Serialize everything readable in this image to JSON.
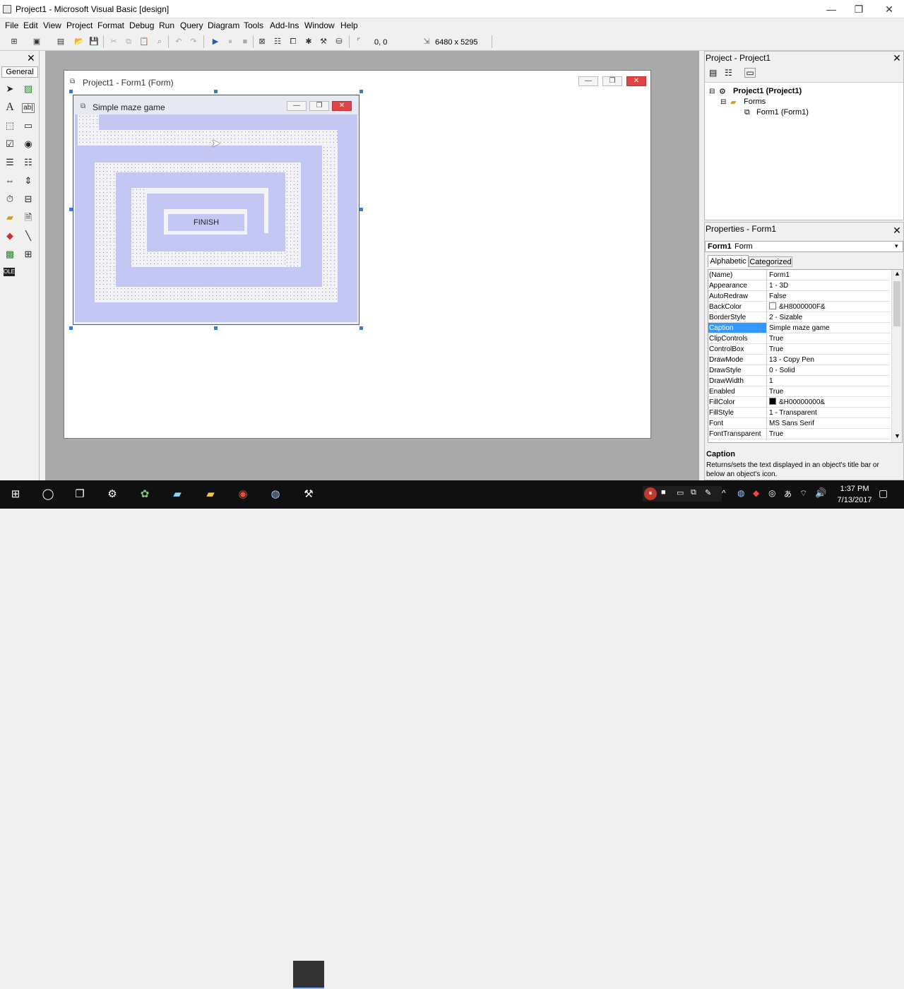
{
  "window": {
    "title": "Project1 - Microsoft Visual Basic [design]"
  },
  "menu": [
    "File",
    "Edit",
    "View",
    "Project",
    "Format",
    "Debug",
    "Run",
    "Query",
    "Diagram",
    "Tools",
    "Add-Ins",
    "Window",
    "Help"
  ],
  "toolbar": {
    "position": "0, 0",
    "size": "6480 x 5295"
  },
  "toolbox": {
    "tab": "General"
  },
  "designer": {
    "title": "Project1 - Form1 (Form)"
  },
  "form": {
    "caption": "Simple maze game",
    "finish_label": "FINISH",
    "backcolor": "#C4C6F4"
  },
  "project": {
    "title": "Project - Project1",
    "root": "Project1 (Project1)",
    "folder": "Forms",
    "item": "Form1 (Form1)"
  },
  "properties": {
    "title": "Properties - Form1",
    "object_name": "Form1",
    "object_type": "Form",
    "tab_alpha": "Alphabetic",
    "tab_cat": "Categorized",
    "rows": [
      {
        "name": "(Name)",
        "value": "Form1"
      },
      {
        "name": "Appearance",
        "value": "1 - 3D"
      },
      {
        "name": "AutoRedraw",
        "value": "False"
      },
      {
        "name": "BackColor",
        "value": "&H8000000F&",
        "swatch": "#ffffff"
      },
      {
        "name": "BorderStyle",
        "value": "2 - Sizable"
      },
      {
        "name": "Caption",
        "value": "Simple maze game",
        "selected": true
      },
      {
        "name": "ClipControls",
        "value": "True"
      },
      {
        "name": "ControlBox",
        "value": "True"
      },
      {
        "name": "DrawMode",
        "value": "13 - Copy Pen"
      },
      {
        "name": "DrawStyle",
        "value": "0 - Solid"
      },
      {
        "name": "DrawWidth",
        "value": "1"
      },
      {
        "name": "Enabled",
        "value": "True"
      },
      {
        "name": "FillColor",
        "value": "&H00000000&",
        "swatch": "#000000"
      },
      {
        "name": "FillStyle",
        "value": "1 - Transparent"
      },
      {
        "name": "Font",
        "value": "MS Sans Serif"
      },
      {
        "name": "FontTransparent",
        "value": "True"
      }
    ],
    "desc_title": "Caption",
    "desc_text": "Returns/sets the text displayed in an object's title bar or below an object's icon."
  },
  "taskbar": {
    "time": "1:37 PM",
    "date": "7/13/2017"
  }
}
